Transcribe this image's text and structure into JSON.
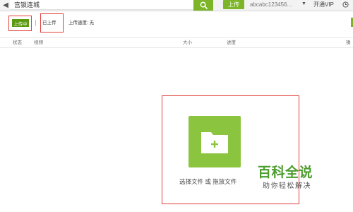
{
  "topbar": {
    "back_icon": "back-arrow-icon",
    "search_value": "宫锁连城",
    "search_icon": "search-icon",
    "upload_label": "上传",
    "username": "abcabc123456...",
    "vip_label": "开通VIP",
    "clock_icon": "clock-icon"
  },
  "tabs": {
    "uploading": "上传中",
    "uploaded": "已上传",
    "speed": "上传速度: 无"
  },
  "table": {
    "columns": [
      "状态",
      "视频",
      "大小",
      "进度",
      "操"
    ]
  },
  "dropzone": {
    "icon": "folder-plus-icon",
    "text": "选择文件 或 拖放文件"
  },
  "watermark": {
    "title": "百科全说",
    "subtitle": "助你轻松解决"
  },
  "colors": {
    "accent": "#7cb527",
    "annotation": "#e0413a",
    "folder_tile": "#8bc53f"
  }
}
